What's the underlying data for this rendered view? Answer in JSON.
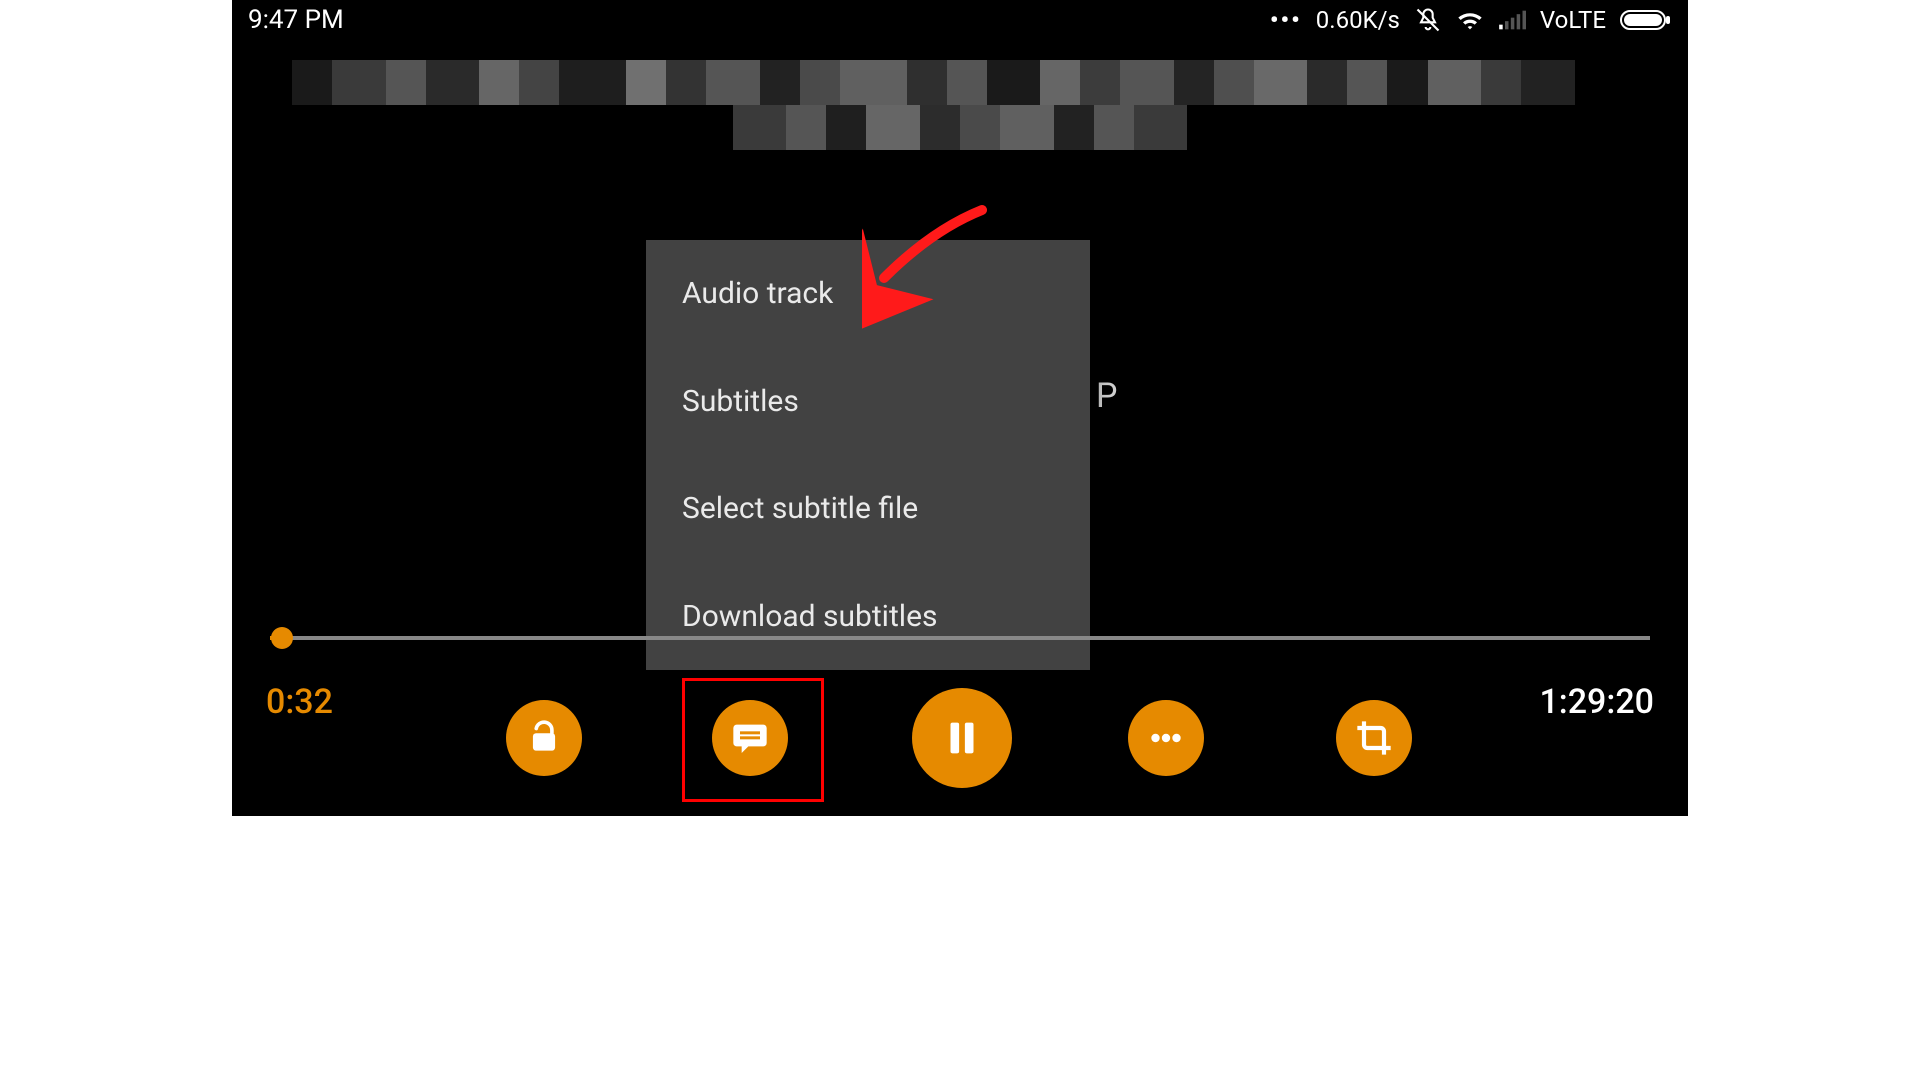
{
  "status": {
    "time": "9:47 PM",
    "netspeed": "0.60K/s",
    "network_label": "VoLTE"
  },
  "menu": {
    "items": [
      {
        "label": "Audio track"
      },
      {
        "label": "Subtitles"
      },
      {
        "label": "Select subtitle file"
      },
      {
        "label": "Download subtitles"
      }
    ]
  },
  "overlay_char": "P",
  "playback": {
    "current": "0:32",
    "duration": "1:29:20"
  },
  "colors": {
    "accent": "#e68a00",
    "popup_bg": "#424242",
    "annotation": "#ff0000"
  }
}
